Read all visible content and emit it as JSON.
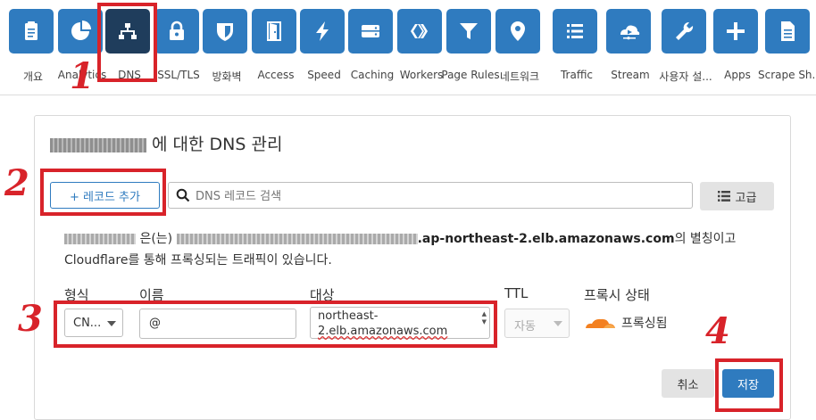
{
  "nav": {
    "items": [
      {
        "label": "개요",
        "icon": "clipboard-icon",
        "active": false
      },
      {
        "label": "Analytics",
        "icon": "pie-chart-icon",
        "active": false
      },
      {
        "label": "DNS",
        "icon": "network-icon",
        "active": true
      },
      {
        "label": "SSL/TLS",
        "icon": "lock-icon",
        "active": false
      },
      {
        "label": "방화벽",
        "icon": "shield-icon",
        "active": false
      },
      {
        "label": "Access",
        "icon": "door-icon",
        "active": false
      },
      {
        "label": "Speed",
        "icon": "lightning-icon",
        "active": false
      },
      {
        "label": "Caching",
        "icon": "drive-icon",
        "active": false
      },
      {
        "label": "Workers",
        "icon": "workers-icon",
        "active": false
      },
      {
        "label": "Page Rules",
        "icon": "filter-icon",
        "active": false
      },
      {
        "label": "네트워크",
        "icon": "location-pin-icon",
        "active": false
      },
      {
        "label": "Traffic",
        "icon": "list-icon",
        "active": false
      },
      {
        "label": "Stream",
        "icon": "cloud-play-icon",
        "active": false
      },
      {
        "label": "사용자 설...",
        "icon": "wrench-icon",
        "active": false
      },
      {
        "label": "Apps",
        "icon": "plus-icon",
        "active": false
      },
      {
        "label": "Scrape Sh...",
        "icon": "document-icon",
        "active": false
      }
    ]
  },
  "card": {
    "title_suffix": "에 대한 DNS 관리",
    "add_record": "+ 레코드 추가",
    "search_placeholder": "DNS 레코드 검색",
    "advanced": "고급",
    "info_mid": "은(는)",
    "info_host": ".ap-northeast-2.elb.amazonaws.com",
    "info_tail": "의 별칭이고",
    "info_line2": "Cloudflare를 통해 프록싱되는 트래픽이 있습니다."
  },
  "form": {
    "col_type": "형식",
    "col_name": "이름",
    "col_target": "대상",
    "col_ttl": "TTL",
    "col_proxy": "프록시 상태",
    "type_value": "CN...",
    "name_value": "@",
    "target_line1": "northeast-",
    "target_line2": "2.elb.amazonaws.com",
    "ttl_value": "자동",
    "proxy_value": "프록싱됨",
    "cancel": "취소",
    "save": "저장"
  },
  "annotations": {
    "n1": "1",
    "n2": "2",
    "n3": "3",
    "n4": "4"
  },
  "colors": {
    "tile": "#2f7bbf",
    "tile_active": "#1f3d5c",
    "annotation": "#d8232a",
    "cloud": "#f38020"
  }
}
